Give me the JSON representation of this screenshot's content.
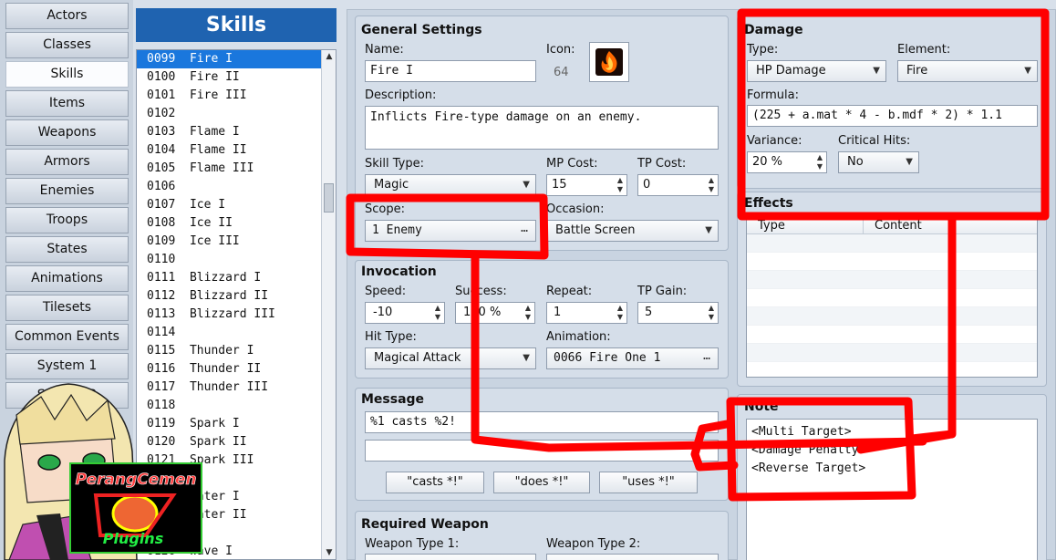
{
  "categories": [
    "Actors",
    "Classes",
    "Skills",
    "Items",
    "Weapons",
    "Armors",
    "Enemies",
    "Troops",
    "States",
    "Animations",
    "Tilesets",
    "Common Events",
    "System 1",
    "System 2"
  ],
  "active_category": "Skills",
  "skills_title": "Skills",
  "skills": [
    "0099  Fire I",
    "0100  Fire II",
    "0101  Fire III",
    "0102",
    "0103  Flame I",
    "0104  Flame II",
    "0105  Flame III",
    "0106",
    "0107  Ice I",
    "0108  Ice II",
    "0109  Ice III",
    "0110",
    "0111  Blizzard I",
    "0112  Blizzard II",
    "0113  Blizzard III",
    "0114",
    "0115  Thunder I",
    "0116  Thunder II",
    "0117  Thunder III",
    "0118",
    "0119  Spark I",
    "0120  Spark II",
    "0121  Spark III",
    "0122",
    "0123  Water I",
    "0124  Water II",
    "0125",
    "0126  Wave I"
  ],
  "general": {
    "title": "General Settings",
    "name_label": "Name:",
    "name_value": "Fire I",
    "icon_label": "Icon:",
    "icon_index": "64",
    "description_label": "Description:",
    "description_value": "Inflicts Fire-type damage on an enemy.",
    "skill_type_label": "Skill Type:",
    "skill_type_value": "Magic",
    "mp_cost_label": "MP Cost:",
    "mp_cost_value": "15",
    "tp_cost_label": "TP Cost:",
    "tp_cost_value": "0",
    "scope_label": "Scope:",
    "scope_value": "1 Enemy",
    "occasion_label": "Occasion:",
    "occasion_value": "Battle Screen"
  },
  "invocation": {
    "title": "Invocation",
    "speed_label": "Speed:",
    "speed_value": "-10",
    "success_label": "Success:",
    "success_value": "100 %",
    "repeat_label": "Repeat:",
    "repeat_value": "1",
    "tp_gain_label": "TP Gain:",
    "tp_gain_value": "5",
    "hit_type_label": "Hit Type:",
    "hit_type_value": "Magical Attack",
    "animation_label": "Animation:",
    "animation_value": "0066 Fire One 1"
  },
  "message": {
    "title": "Message",
    "line1": "%1 casts %2!",
    "line2": "",
    "buttons": [
      "\"casts *!\"",
      "\"does *!\"",
      "\"uses *!\""
    ]
  },
  "required_weapon": {
    "title": "Required Weapon",
    "type1_label": "Weapon Type 1:",
    "type2_label": "Weapon Type 2:"
  },
  "damage": {
    "title": "Damage",
    "type_label": "Type:",
    "type_value": "HP Damage",
    "element_label": "Element:",
    "element_value": "Fire",
    "formula_label": "Formula:",
    "formula_value": "(225 + a.mat * 4 - b.mdf * 2) * 1.1",
    "variance_label": "Variance:",
    "variance_value": "20 %",
    "critical_label": "Critical Hits:",
    "critical_value": "No"
  },
  "effects": {
    "title": "Effects",
    "columns": [
      "Type",
      "Content"
    ]
  },
  "note": {
    "title": "Note",
    "text": "<Multi Target>\n<Damage Penalty>\n<Reverse Target>"
  },
  "watermark": {
    "line1": "PerangCemen",
    "line2": "Plugins"
  },
  "colors": {
    "selection": "#1a77dd",
    "header": "#1f63b0",
    "annotation": "#ff0000"
  }
}
